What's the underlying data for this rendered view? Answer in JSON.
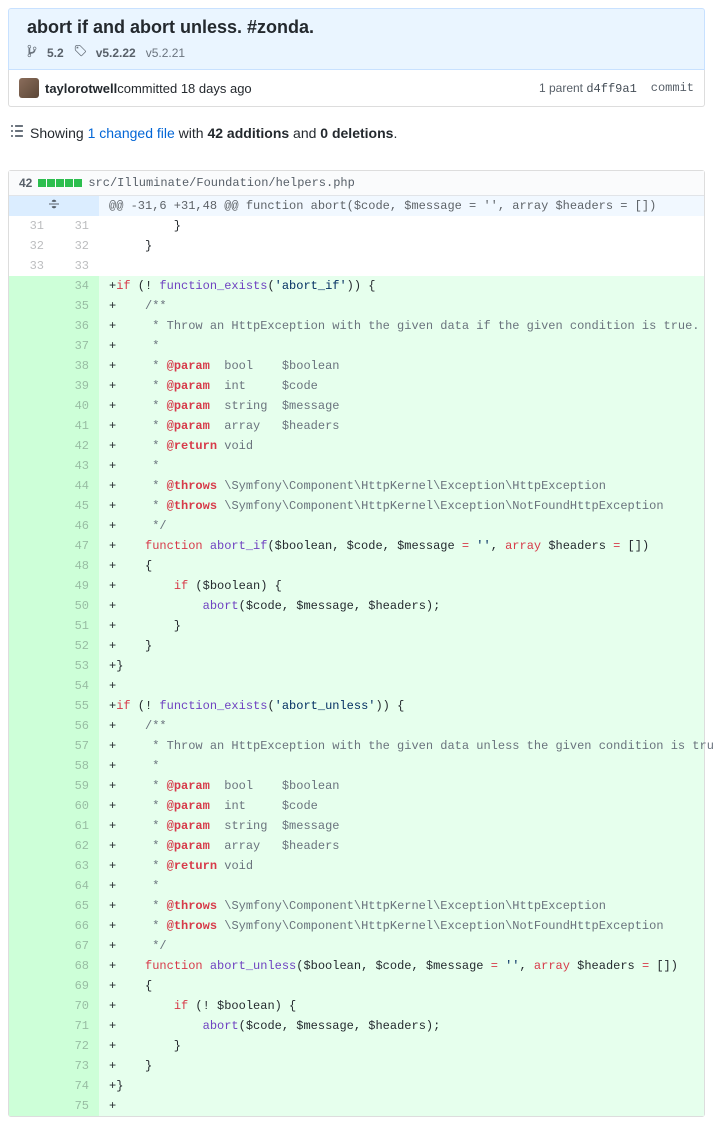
{
  "commit": {
    "title": "abort if and abort unless. #zonda.",
    "branch": "5.2",
    "tag_bold": "v5.2.22",
    "tag_muted": "v5.2.21",
    "author": "taylorotwell",
    "action": " committed 18 days ago",
    "parent_label": "1 parent ",
    "parent_sha": "d4ff9a1",
    "commit_link": "commit"
  },
  "summary": {
    "pre": "Showing ",
    "changed_files": "1 changed file",
    "mid1": " with ",
    "additions": "42 additions",
    "mid2": " and ",
    "deletions": "0 deletions",
    "end": "."
  },
  "file": {
    "diffstat_num": "42",
    "path": "src/Illuminate/Foundation/helpers.php",
    "hunk_header": "@@ -31,6 +31,48 @@ function abort($code, $message = '', array $headers = [])"
  },
  "diff": [
    {
      "t": "ctx",
      "l": "31",
      "r": "31",
      "txt": "        }"
    },
    {
      "t": "ctx",
      "l": "32",
      "r": "32",
      "txt": "    }"
    },
    {
      "t": "ctx",
      "l": "33",
      "r": "33",
      "txt": ""
    },
    {
      "t": "add",
      "r": "34",
      "seg": [
        "+",
        [
          "k",
          "if"
        ],
        " (! ",
        [
          "e",
          "function_exists"
        ],
        "(",
        [
          "s",
          "'abort_if'"
        ],
        ")) {"
      ]
    },
    {
      "t": "add",
      "r": "35",
      "seg": [
        "+    ",
        [
          "c",
          "/**"
        ]
      ]
    },
    {
      "t": "add",
      "r": "36",
      "seg": [
        "+    ",
        [
          "c",
          " * Throw an HttpException with the given data if the given condition is true."
        ]
      ]
    },
    {
      "t": "add",
      "r": "37",
      "seg": [
        "+    ",
        [
          "c",
          " *"
        ]
      ]
    },
    {
      "t": "add",
      "r": "38",
      "seg": [
        "+    ",
        [
          "c",
          " * "
        ],
        [
          "tag",
          "@param"
        ],
        [
          "c",
          "  bool    $boolean"
        ]
      ]
    },
    {
      "t": "add",
      "r": "39",
      "seg": [
        "+    ",
        [
          "c",
          " * "
        ],
        [
          "tag",
          "@param"
        ],
        [
          "c",
          "  int     $code"
        ]
      ]
    },
    {
      "t": "add",
      "r": "40",
      "seg": [
        "+    ",
        [
          "c",
          " * "
        ],
        [
          "tag",
          "@param"
        ],
        [
          "c",
          "  string  $message"
        ]
      ]
    },
    {
      "t": "add",
      "r": "41",
      "seg": [
        "+    ",
        [
          "c",
          " * "
        ],
        [
          "tag",
          "@param"
        ],
        [
          "c",
          "  array   $headers"
        ]
      ]
    },
    {
      "t": "add",
      "r": "42",
      "seg": [
        "+    ",
        [
          "c",
          " * "
        ],
        [
          "tag",
          "@return"
        ],
        [
          "c",
          " void"
        ]
      ]
    },
    {
      "t": "add",
      "r": "43",
      "seg": [
        "+    ",
        [
          "c",
          " *"
        ]
      ]
    },
    {
      "t": "add",
      "r": "44",
      "seg": [
        "+    ",
        [
          "c",
          " * "
        ],
        [
          "tag",
          "@throws"
        ],
        [
          "c",
          " \\Symfony\\Component\\HttpKernel\\Exception\\HttpException"
        ]
      ]
    },
    {
      "t": "add",
      "r": "45",
      "seg": [
        "+    ",
        [
          "c",
          " * "
        ],
        [
          "tag",
          "@throws"
        ],
        [
          "c",
          " \\Symfony\\Component\\HttpKernel\\Exception\\NotFoundHttpException"
        ]
      ]
    },
    {
      "t": "add",
      "r": "46",
      "seg": [
        "+    ",
        [
          "c",
          " */"
        ]
      ]
    },
    {
      "t": "add",
      "r": "47",
      "seg": [
        "+    ",
        [
          "k",
          "function"
        ],
        " ",
        [
          "e",
          "abort_if"
        ],
        "(",
        [
          "s1",
          "$boolean"
        ],
        ", ",
        [
          "s1",
          "$code"
        ],
        ", ",
        [
          "s1",
          "$message"
        ],
        " ",
        [
          "k",
          "="
        ],
        " ",
        [
          "s",
          "''"
        ],
        ", ",
        [
          "k",
          "array"
        ],
        " ",
        [
          "s1",
          "$headers"
        ],
        " ",
        [
          "k",
          "="
        ],
        " [])"
      ]
    },
    {
      "t": "add",
      "r": "48",
      "seg": [
        "+    {"
      ]
    },
    {
      "t": "add",
      "r": "49",
      "seg": [
        "+        ",
        [
          "k",
          "if"
        ],
        " (",
        [
          "s1",
          "$boolean"
        ],
        ") {"
      ]
    },
    {
      "t": "add",
      "r": "50",
      "seg": [
        "+            ",
        [
          "e",
          "abort"
        ],
        "(",
        [
          "s1",
          "$code"
        ],
        ", ",
        [
          "s1",
          "$message"
        ],
        ", ",
        [
          "s1",
          "$headers"
        ],
        ");"
      ]
    },
    {
      "t": "add",
      "r": "51",
      "seg": [
        "+        }"
      ]
    },
    {
      "t": "add",
      "r": "52",
      "seg": [
        "+    }"
      ]
    },
    {
      "t": "add",
      "r": "53",
      "seg": [
        "+}"
      ]
    },
    {
      "t": "add",
      "r": "54",
      "seg": [
        "+"
      ]
    },
    {
      "t": "add",
      "r": "55",
      "seg": [
        "+",
        [
          "k",
          "if"
        ],
        " (! ",
        [
          "e",
          "function_exists"
        ],
        "(",
        [
          "s",
          "'abort_unless'"
        ],
        ")) {"
      ]
    },
    {
      "t": "add",
      "r": "56",
      "seg": [
        "+    ",
        [
          "c",
          "/**"
        ]
      ]
    },
    {
      "t": "add",
      "r": "57",
      "seg": [
        "+    ",
        [
          "c",
          " * Throw an HttpException with the given data unless the given condition is true."
        ]
      ]
    },
    {
      "t": "add",
      "r": "58",
      "seg": [
        "+    ",
        [
          "c",
          " *"
        ]
      ]
    },
    {
      "t": "add",
      "r": "59",
      "seg": [
        "+    ",
        [
          "c",
          " * "
        ],
        [
          "tag",
          "@param"
        ],
        [
          "c",
          "  bool    $boolean"
        ]
      ]
    },
    {
      "t": "add",
      "r": "60",
      "seg": [
        "+    ",
        [
          "c",
          " * "
        ],
        [
          "tag",
          "@param"
        ],
        [
          "c",
          "  int     $code"
        ]
      ]
    },
    {
      "t": "add",
      "r": "61",
      "seg": [
        "+    ",
        [
          "c",
          " * "
        ],
        [
          "tag",
          "@param"
        ],
        [
          "c",
          "  string  $message"
        ]
      ]
    },
    {
      "t": "add",
      "r": "62",
      "seg": [
        "+    ",
        [
          "c",
          " * "
        ],
        [
          "tag",
          "@param"
        ],
        [
          "c",
          "  array   $headers"
        ]
      ]
    },
    {
      "t": "add",
      "r": "63",
      "seg": [
        "+    ",
        [
          "c",
          " * "
        ],
        [
          "tag",
          "@return"
        ],
        [
          "c",
          " void"
        ]
      ]
    },
    {
      "t": "add",
      "r": "64",
      "seg": [
        "+    ",
        [
          "c",
          " *"
        ]
      ]
    },
    {
      "t": "add",
      "r": "65",
      "seg": [
        "+    ",
        [
          "c",
          " * "
        ],
        [
          "tag",
          "@throws"
        ],
        [
          "c",
          " \\Symfony\\Component\\HttpKernel\\Exception\\HttpException"
        ]
      ]
    },
    {
      "t": "add",
      "r": "66",
      "seg": [
        "+    ",
        [
          "c",
          " * "
        ],
        [
          "tag",
          "@throws"
        ],
        [
          "c",
          " \\Symfony\\Component\\HttpKernel\\Exception\\NotFoundHttpException"
        ]
      ]
    },
    {
      "t": "add",
      "r": "67",
      "seg": [
        "+    ",
        [
          "c",
          " */"
        ]
      ]
    },
    {
      "t": "add",
      "r": "68",
      "seg": [
        "+    ",
        [
          "k",
          "function"
        ],
        " ",
        [
          "e",
          "abort_unless"
        ],
        "(",
        [
          "s1",
          "$boolean"
        ],
        ", ",
        [
          "s1",
          "$code"
        ],
        ", ",
        [
          "s1",
          "$message"
        ],
        " ",
        [
          "k",
          "="
        ],
        " ",
        [
          "s",
          "''"
        ],
        ", ",
        [
          "k",
          "array"
        ],
        " ",
        [
          "s1",
          "$headers"
        ],
        " ",
        [
          "k",
          "="
        ],
        " [])"
      ]
    },
    {
      "t": "add",
      "r": "69",
      "seg": [
        "+    {"
      ]
    },
    {
      "t": "add",
      "r": "70",
      "seg": [
        "+        ",
        [
          "k",
          "if"
        ],
        " (! ",
        [
          "s1",
          "$boolean"
        ],
        ") {"
      ]
    },
    {
      "t": "add",
      "r": "71",
      "seg": [
        "+            ",
        [
          "e",
          "abort"
        ],
        "(",
        [
          "s1",
          "$code"
        ],
        ", ",
        [
          "s1",
          "$message"
        ],
        ", ",
        [
          "s1",
          "$headers"
        ],
        ");"
      ]
    },
    {
      "t": "add",
      "r": "72",
      "seg": [
        "+        }"
      ]
    },
    {
      "t": "add",
      "r": "73",
      "seg": [
        "+    }"
      ]
    },
    {
      "t": "add",
      "r": "74",
      "seg": [
        "+}"
      ]
    },
    {
      "t": "add",
      "r": "75",
      "seg": [
        "+"
      ]
    }
  ]
}
